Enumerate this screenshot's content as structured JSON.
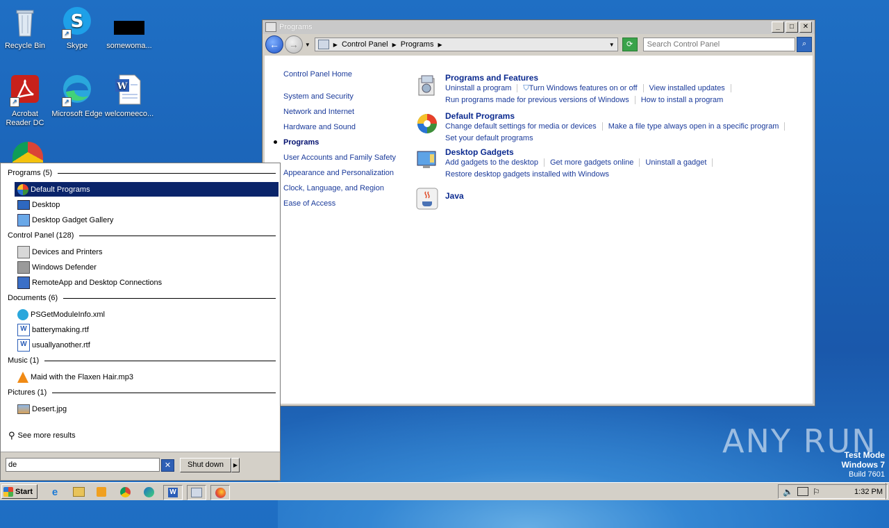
{
  "desktop": {
    "icons": [
      {
        "label": "Recycle Bin"
      },
      {
        "label": "Skype"
      },
      {
        "label": "somewoma..."
      },
      {
        "label": "Acrobat Reader DC"
      },
      {
        "label": "Microsoft Edge"
      },
      {
        "label": "welcomeeco..."
      }
    ],
    "watermark": "ANY RUN",
    "test_mode": {
      "line1": "Test Mode",
      "line2": "Windows 7",
      "line3": "Build 7601"
    }
  },
  "window": {
    "title": "Programs",
    "breadcrumb": [
      "Control Panel",
      "Programs"
    ],
    "search_placeholder": "Search Control Panel",
    "leftnav": {
      "home": "Control Panel Home",
      "items": [
        "System and Security",
        "Network and Internet",
        "Hardware and Sound",
        "Programs",
        "User Accounts and Family Safety",
        "Appearance and Personalization",
        "Clock, Language, and Region",
        "Ease of Access"
      ]
    },
    "categories": [
      {
        "title": "Programs and Features",
        "links": [
          "Uninstall a program",
          "Turn Windows features on or off",
          "View installed updates",
          "Run programs made for previous versions of Windows",
          "How to install a program"
        ]
      },
      {
        "title": "Default Programs",
        "links": [
          "Change default settings for media or devices",
          "Make a file type always open in a specific program",
          "Set your default programs"
        ]
      },
      {
        "title": "Desktop Gadgets",
        "links": [
          "Add gadgets to the desktop",
          "Get more gadgets online",
          "Uninstall a gadget",
          "Restore desktop gadgets installed with Windows"
        ]
      },
      {
        "title": "Java",
        "links": []
      }
    ]
  },
  "start_menu": {
    "sections": [
      {
        "title": "Programs (5)",
        "items": [
          "Default Programs",
          "Desktop",
          "Desktop Gadget Gallery"
        ]
      },
      {
        "title": "Control Panel (128)",
        "items": [
          "Devices and Printers",
          "Windows Defender",
          "RemoteApp and Desktop Connections"
        ]
      },
      {
        "title": "Documents (6)",
        "items": [
          "PSGetModuleInfo.xml",
          "batterymaking.rtf",
          "usuallyanother.rtf"
        ]
      },
      {
        "title": "Music (1)",
        "items": [
          "Maid with the Flaxen Hair.mp3"
        ]
      },
      {
        "title": "Pictures (1)",
        "items": [
          "Desert.jpg"
        ]
      }
    ],
    "see_more": "See more results",
    "search_value": "de",
    "shutdown_label": "Shut down"
  },
  "taskbar": {
    "start_label": "Start",
    "clock": "1:32 PM"
  }
}
